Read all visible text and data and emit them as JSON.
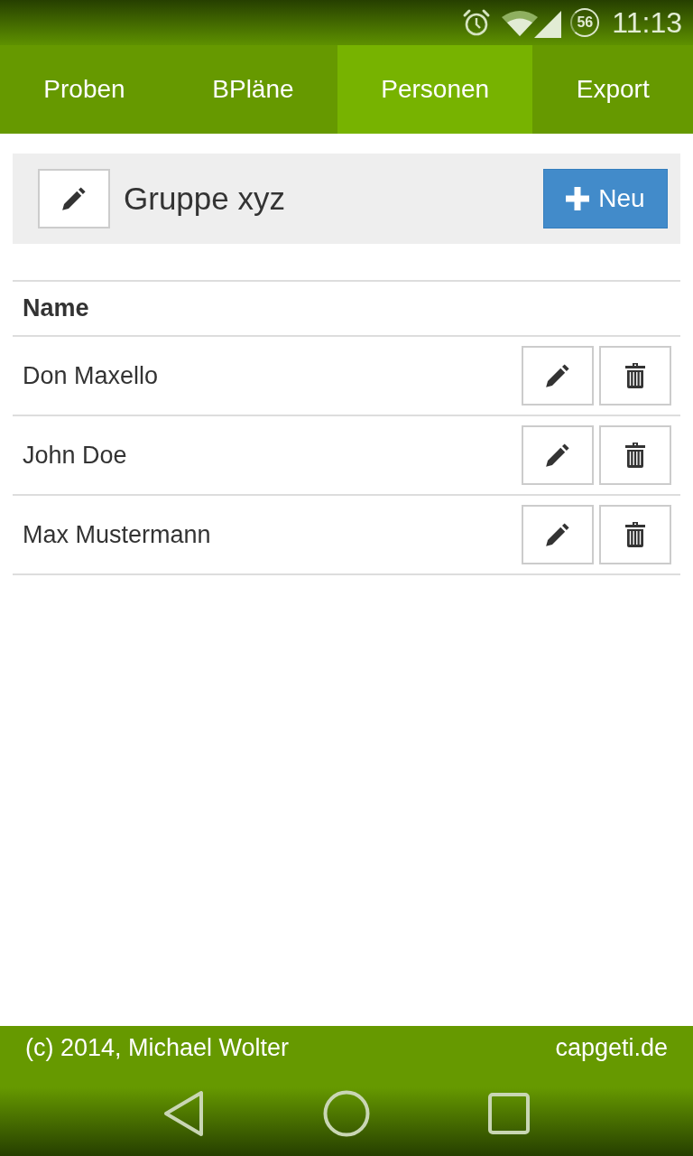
{
  "status_bar": {
    "battery_text": "56",
    "time": "11:13"
  },
  "tabs": [
    {
      "label": "Proben",
      "selected": false
    },
    {
      "label": "BPläne",
      "selected": false
    },
    {
      "label": "Personen",
      "selected": true
    },
    {
      "label": "Export",
      "selected": false
    }
  ],
  "group": {
    "name": "Gruppe xyz",
    "new_button": "Neu"
  },
  "table": {
    "columns": [
      "Name"
    ],
    "rows": [
      {
        "name": "Don Maxello"
      },
      {
        "name": "John Doe"
      },
      {
        "name": "Max Mustermann"
      }
    ]
  },
  "footer": {
    "copyright": "(c) 2014, Michael Wolter",
    "site": "capgeti.de"
  }
}
